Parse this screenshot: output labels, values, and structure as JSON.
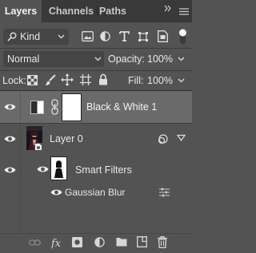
{
  "tabs": [
    "Layers",
    "Channels",
    "Paths"
  ],
  "filter": {
    "kind_label": "Kind"
  },
  "blend": {
    "mode": "Normal",
    "opacity_label": "Opacity:",
    "opacity_value": "100%"
  },
  "lock": {
    "label": "Lock:",
    "fill_label": "Fill:",
    "fill_value": "100%"
  },
  "layers": {
    "adjustment_name": "Black & White 1",
    "layer0_name": "Layer 0",
    "smart_filters_label": "Smart Filters",
    "filter_name": "Gaussian Blur"
  },
  "colors": {
    "panel_bg": "#535353",
    "tab_bg": "#393939",
    "selected_row": "#6a6a6a"
  }
}
